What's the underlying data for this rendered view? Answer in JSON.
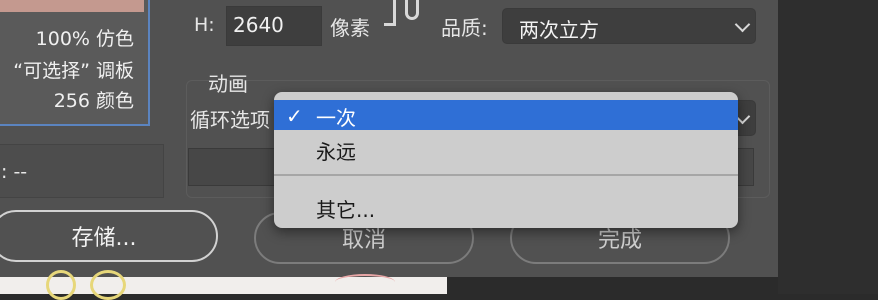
{
  "export": {
    "height_label": "H:",
    "height_value": "2640",
    "height_unit": "像素",
    "quality_label": "品质:",
    "quality_value": "两次立方"
  },
  "preview": {
    "info_lines": [
      "100% 仿色",
      "“可选择” 调板",
      "256 颜色"
    ],
    "stat_text": ": --"
  },
  "animation": {
    "group_title": "动画",
    "loop_label": "循环选项"
  },
  "loop_menu": {
    "items": [
      "一次",
      "永远",
      "其它..."
    ],
    "selected": "一次"
  },
  "buttons": {
    "save": "存储...",
    "cancel": "取消",
    "done": "完成"
  },
  "colors": {
    "dialog_bg": "#515151",
    "menu_bg": "#cdcdcd",
    "menu_selected": "#2f6fd6",
    "preview_border": "#5b84c0"
  }
}
